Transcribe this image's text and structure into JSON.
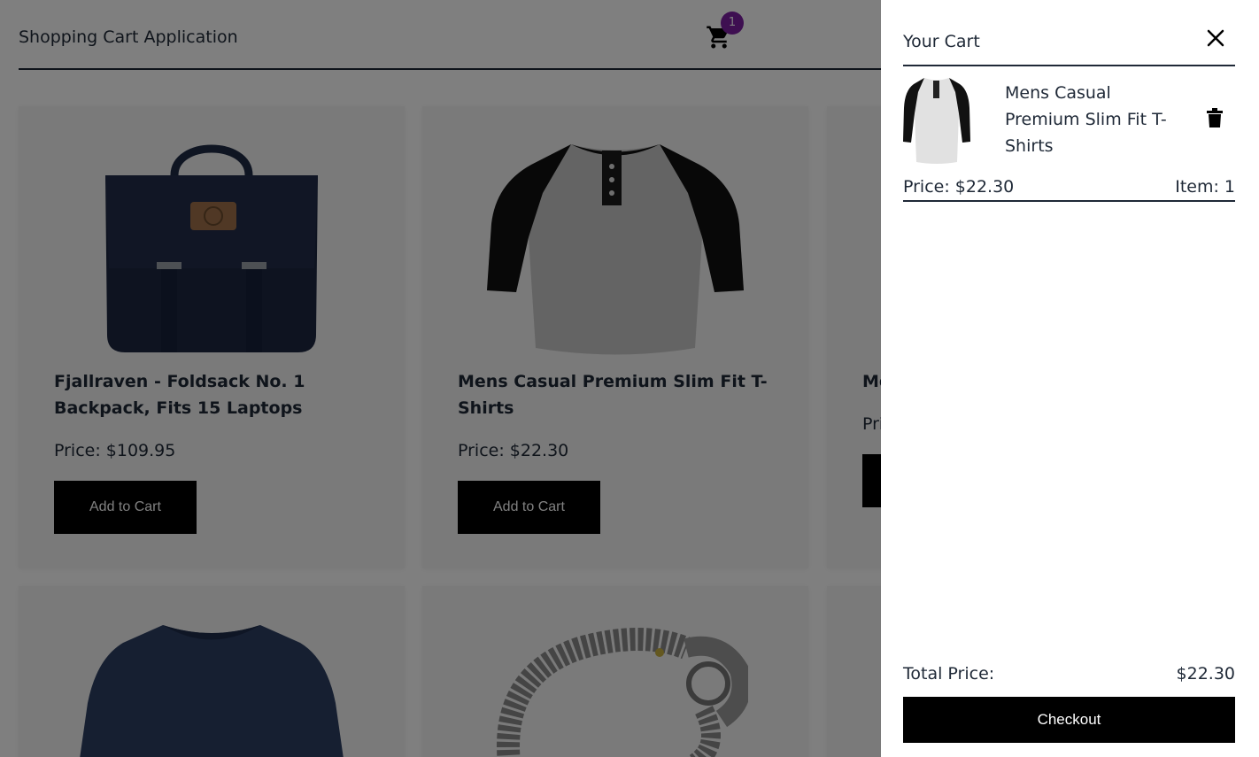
{
  "app": {
    "title": "Shopping Cart Application"
  },
  "header": {
    "cart_icon": "cart-icon",
    "cart_count": "1",
    "badge_color": "#7c1fa2"
  },
  "products": [
    {
      "name": "Fjallraven - Foldsack No. 1 Backpack, Fits 15 Laptops",
      "price": "Price: $109.95",
      "button": "Add to Cart",
      "image": "backpack"
    },
    {
      "name": "Mens Casual Premium Slim Fit T-Shirts",
      "price": "Price: $22.30",
      "button": "Add to Cart",
      "image": "raglan-tshirt"
    },
    {
      "name": "Mo",
      "price": "Pri",
      "button": "",
      "image": ""
    },
    {
      "name": "",
      "price": "",
      "button": "",
      "image": "long-sleeve-shirt"
    },
    {
      "name": "",
      "price": "",
      "button": "",
      "image": "dragon-bracelet"
    }
  ],
  "cart": {
    "title": "Your Cart",
    "close_icon": "close-icon",
    "items": [
      {
        "name": "Mens Casual Premium Slim Fit T-Shirts",
        "price": "Price: $22.30",
        "qty": "Item: 1",
        "delete_icon": "trash-icon"
      }
    ],
    "total_label": "Total Price:",
    "total_value": "$22.30",
    "checkout": "Checkout"
  }
}
